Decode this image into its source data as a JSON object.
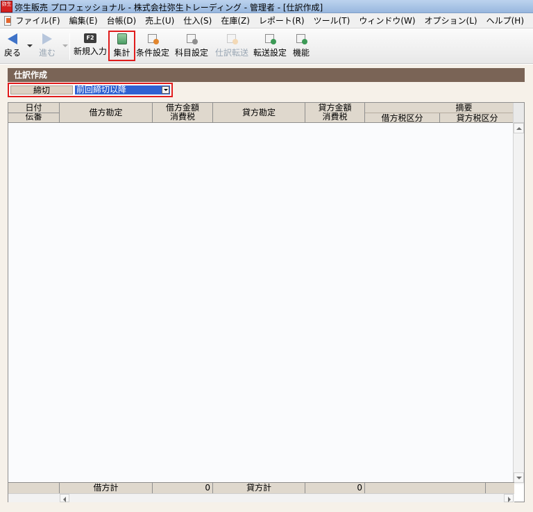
{
  "window": {
    "app_icon_text": "弥生",
    "title": "弥生販売 プロフェッショナル - 株式会社弥生トレーディング - 管理者 - [仕訳作成]"
  },
  "menu": [
    "ファイル(F)",
    "編集(E)",
    "台帳(D)",
    "売上(U)",
    "仕入(S)",
    "在庫(Z)",
    "レポート(R)",
    "ツール(T)",
    "ウィンドウ(W)",
    "オプション(L)",
    "ヘルプ(H)"
  ],
  "toolbar": {
    "back": "戻る",
    "forward": "進む",
    "f2_key": "F2",
    "new_entry": "新規入力",
    "sum": "集計",
    "conditions": "条件設定",
    "accounts": "科目設定",
    "journal_send": "仕訳転送",
    "transfer_settings": "転送設定",
    "function": "機能"
  },
  "section": {
    "title": "仕訳作成"
  },
  "filter": {
    "label": "締切",
    "value": "前回締切以降"
  },
  "grid": {
    "headers": {
      "date": "日付",
      "slip_no": "伝番",
      "debit_account": "借方勘定",
      "debit_amount": "借方金額",
      "debit_tax": "消費税",
      "credit_account": "貸方勘定",
      "credit_amount": "貸方金額",
      "credit_tax": "消費税",
      "memo": "摘要",
      "debit_tax_class": "借方税区分",
      "credit_tax_class": "貸方税区分"
    },
    "totals": {
      "debit_label": "借方計",
      "debit_value": "0",
      "credit_label": "貸方計",
      "credit_value": "0"
    }
  },
  "colors": {
    "highlight": "#e01c1c",
    "section_bar": "#7a6456",
    "select_bg": "#2f62d2",
    "panel_bg": "#f6f1e9"
  }
}
